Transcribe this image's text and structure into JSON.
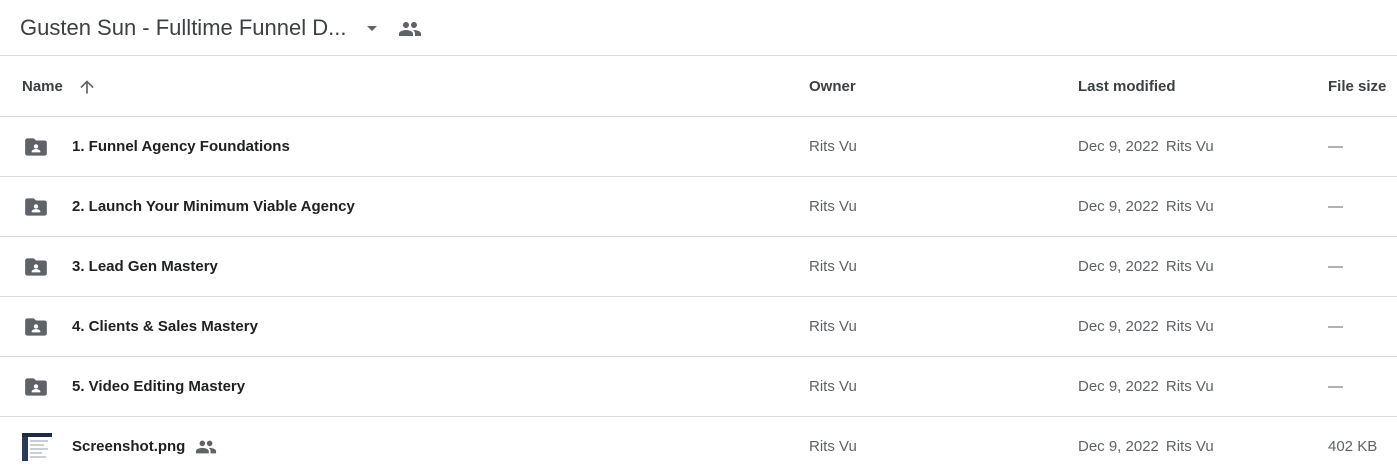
{
  "header": {
    "title": "Gusten Sun - Fulltime Funnel D...",
    "caret_icon": "arrow-drop-down-icon",
    "shared_icon": "shared-people-icon"
  },
  "columns": {
    "name": "Name",
    "owner": "Owner",
    "last_modified": "Last modified",
    "file_size": "File size",
    "sort_icon": "arrow-up-icon"
  },
  "rows": [
    {
      "type": "shared-folder",
      "name": "1. Funnel Agency Foundations",
      "owner": "Rits Vu",
      "modified_date": "Dec 9, 2022",
      "modified_by": "Rits Vu",
      "size": "—"
    },
    {
      "type": "shared-folder",
      "name": "2. Launch Your Minimum Viable Agency",
      "owner": "Rits Vu",
      "modified_date": "Dec 9, 2022",
      "modified_by": "Rits Vu",
      "size": "—"
    },
    {
      "type": "shared-folder",
      "name": "3. Lead Gen Mastery",
      "owner": "Rits Vu",
      "modified_date": "Dec 9, 2022",
      "modified_by": "Rits Vu",
      "size": "—"
    },
    {
      "type": "shared-folder",
      "name": "4. Clients & Sales Mastery",
      "owner": "Rits Vu",
      "modified_date": "Dec 9, 2022",
      "modified_by": "Rits Vu",
      "size": "—"
    },
    {
      "type": "shared-folder",
      "name": "5. Video Editing Mastery",
      "owner": "Rits Vu",
      "modified_date": "Dec 9, 2022",
      "modified_by": "Rits Vu",
      "size": "—"
    },
    {
      "type": "image",
      "name": "Screenshot.png",
      "owner": "Rits Vu",
      "modified_date": "Dec 9, 2022",
      "modified_by": "Rits Vu",
      "size": "402 KB"
    }
  ],
  "colors": {
    "icon_gray": "#5f6368",
    "divider": "#dadce0",
    "text": "#202124"
  }
}
